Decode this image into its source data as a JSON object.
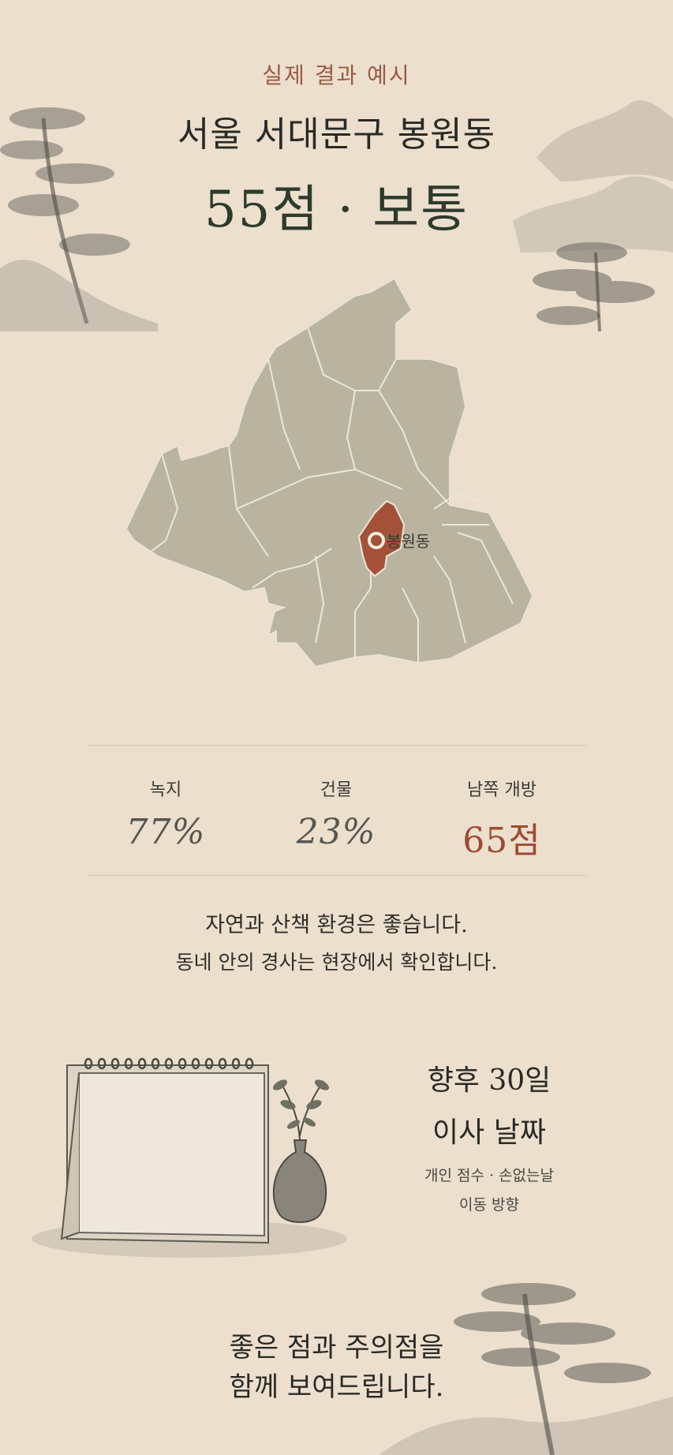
{
  "header": {
    "eyebrow": "실제 결과 예시",
    "title": "서울 서대문구 봉원동",
    "score": "55점 · 보통"
  },
  "map": {
    "highlight_label": "봉원동",
    "highlight_color": "#a4513a",
    "district_color": "#b9b3a0"
  },
  "stats": [
    {
      "label": "녹지",
      "value": "77%"
    },
    {
      "label": "건물",
      "value": "23%"
    },
    {
      "label": "남쪽 개방",
      "value": "65점"
    }
  ],
  "summary": {
    "line1": "자연과 산책 환경은 좋습니다.",
    "line2": "동네 안의 경사는 현장에서 확인합니다."
  },
  "calendar": {
    "title_line1": "향후 30일",
    "title_line2": "이사 날짜",
    "sub_line1": "개인 점수 · 손없는날",
    "sub_line2": "이동 방향"
  },
  "footer": {
    "line1": "좋은 점과 주의점을",
    "line2": "함께 보여드립니다."
  },
  "colors": {
    "background": "#ecdfcd",
    "accent": "#9d4b32",
    "ink": "#2a2a25"
  }
}
